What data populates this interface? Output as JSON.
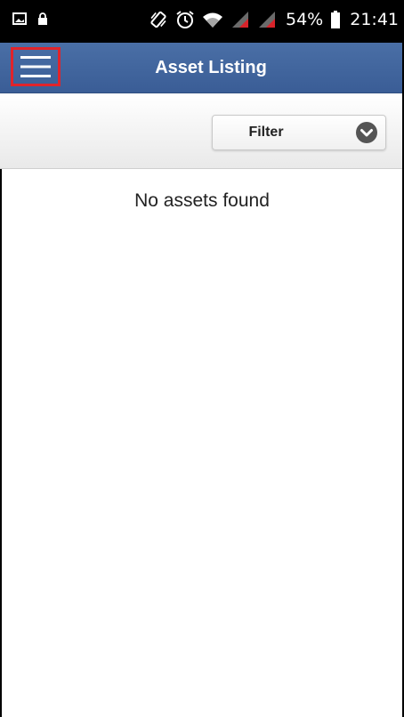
{
  "status_bar": {
    "left_icons": [
      "image-icon",
      "lock-icon"
    ],
    "right_icons": [
      "vibrate-icon",
      "alarm-icon",
      "wifi-icon",
      "signal-icon",
      "signal-icon",
      "battery-icon"
    ],
    "battery_percent": "54%",
    "time": "21:41"
  },
  "header": {
    "title": "Asset Listing",
    "menu_icon": "hamburger-menu-icon",
    "background": "#3f639c",
    "highlight_color": "#e0242b"
  },
  "filter": {
    "label": "Filter",
    "icon": "chevron-down-circle-icon"
  },
  "content": {
    "empty_message": "No assets found"
  }
}
